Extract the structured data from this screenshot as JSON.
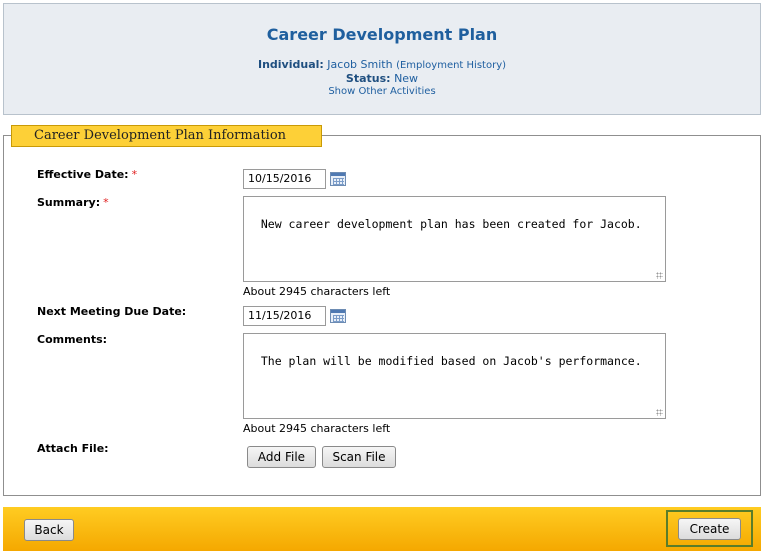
{
  "header": {
    "title": "Career Development Plan",
    "individual_label": "Individual:",
    "individual_name": "Jacob Smith",
    "employment_history_link": "(Employment History)",
    "status_label": "Status:",
    "status_value": "New",
    "show_other_activities": "Show Other Activities"
  },
  "section": {
    "legend": "Career Development Plan Information"
  },
  "form": {
    "effective_date": {
      "label": "Effective Date:",
      "required": "*",
      "value": "10/15/2016",
      "icon": "calendar-icon"
    },
    "summary": {
      "label": "Summary:",
      "required": "*",
      "value": "New career development plan has been created for Jacob.",
      "counter": "About 2945 characters left"
    },
    "next_meeting": {
      "label": "Next Meeting Due Date:",
      "value": "11/15/2016",
      "icon": "calendar-icon"
    },
    "comments": {
      "label": "Comments:",
      "value": "The plan will be modified based on Jacob's performance.",
      "counter": "About 2945 characters left"
    },
    "attach": {
      "label": "Attach File:",
      "add_file": "Add File",
      "scan_file": "Scan File"
    }
  },
  "footer": {
    "back": "Back",
    "create": "Create"
  },
  "colors": {
    "title": "#1f5f9e",
    "header_bg": "#e9edf2",
    "legend_bg": "#fdd037",
    "footer_bg": "#f5b800",
    "required": "#e02020",
    "create_frame": "#5a7d2a"
  }
}
